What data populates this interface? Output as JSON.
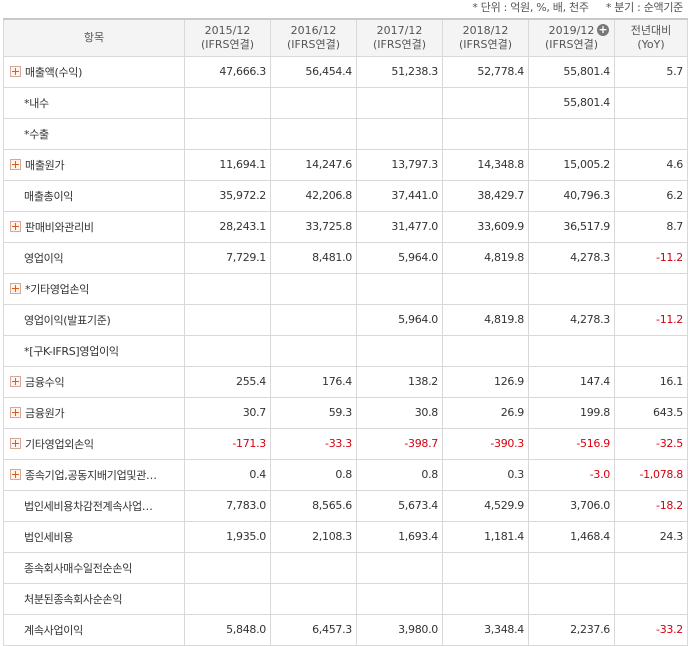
{
  "notes": {
    "unit": "* 단위 : 억원, %, 배, 천주",
    "quarter": "* 분기 : 순액기준"
  },
  "header": {
    "item": "항목",
    "periods": [
      {
        "year": "2015/12",
        "basis": "(IFRS연결)"
      },
      {
        "year": "2016/12",
        "basis": "(IFRS연결)"
      },
      {
        "year": "2017/12",
        "basis": "(IFRS연결)"
      },
      {
        "year": "2018/12",
        "basis": "(IFRS연결)"
      },
      {
        "year": "2019/12",
        "basis": "(IFRS연결)"
      }
    ],
    "yoy_line1": "전년대비",
    "yoy_line2": "(YoY)"
  },
  "rows": [
    {
      "label": "매출액(수익)",
      "expandable": true,
      "values": [
        "47,666.3",
        "56,454.4",
        "51,238.3",
        "52,778.4",
        "55,801.4",
        "5.7"
      ]
    },
    {
      "label": "*내수",
      "expandable": false,
      "values": [
        "",
        "",
        "",
        "",
        "55,801.4",
        ""
      ]
    },
    {
      "label": "*수출",
      "expandable": false,
      "values": [
        "",
        "",
        "",
        "",
        "",
        ""
      ]
    },
    {
      "label": "매출원가",
      "expandable": true,
      "values": [
        "11,694.1",
        "14,247.6",
        "13,797.3",
        "14,348.8",
        "15,005.2",
        "4.6"
      ]
    },
    {
      "label": "매출총이익",
      "expandable": false,
      "values": [
        "35,972.2",
        "42,206.8",
        "37,441.0",
        "38,429.7",
        "40,796.3",
        "6.2"
      ]
    },
    {
      "label": "판매비와관리비",
      "expandable": true,
      "values": [
        "28,243.1",
        "33,725.8",
        "31,477.0",
        "33,609.9",
        "36,517.9",
        "8.7"
      ]
    },
    {
      "label": "영업이익",
      "expandable": false,
      "values": [
        "7,729.1",
        "8,481.0",
        "5,964.0",
        "4,819.8",
        "4,278.3",
        "-11.2"
      ]
    },
    {
      "label": "*기타영업손익",
      "expandable": true,
      "values": [
        "",
        "",
        "",
        "",
        "",
        ""
      ]
    },
    {
      "label": "영업이익(발표기준)",
      "expandable": false,
      "values": [
        "",
        "",
        "5,964.0",
        "4,819.8",
        "4,278.3",
        "-11.2"
      ]
    },
    {
      "label": "*[구K-IFRS]영업이익",
      "expandable": false,
      "values": [
        "",
        "",
        "",
        "",
        "",
        ""
      ]
    },
    {
      "label": "금융수익",
      "expandable": true,
      "values": [
        "255.4",
        "176.4",
        "138.2",
        "126.9",
        "147.4",
        "16.1"
      ]
    },
    {
      "label": "금융원가",
      "expandable": true,
      "values": [
        "30.7",
        "59.3",
        "30.8",
        "26.9",
        "199.8",
        "643.5"
      ]
    },
    {
      "label": "기타영업외손익",
      "expandable": true,
      "values": [
        "-171.3",
        "-33.3",
        "-398.7",
        "-390.3",
        "-516.9",
        "-32.5"
      ]
    },
    {
      "label": "종속기업,공동지배기업및관…",
      "expandable": true,
      "values": [
        "0.4",
        "0.8",
        "0.8",
        "0.3",
        "-3.0",
        "-1,078.8"
      ]
    },
    {
      "label": "법인세비용차감전계속사업…",
      "expandable": false,
      "values": [
        "7,783.0",
        "8,565.6",
        "5,673.4",
        "4,529.9",
        "3,706.0",
        "-18.2"
      ]
    },
    {
      "label": "법인세비용",
      "expandable": false,
      "values": [
        "1,935.0",
        "2,108.3",
        "1,693.4",
        "1,181.4",
        "1,468.4",
        "24.3"
      ]
    },
    {
      "label": "종속회사매수일전순손익",
      "expandable": false,
      "values": [
        "",
        "",
        "",
        "",
        "",
        ""
      ]
    },
    {
      "label": "처분된종속회사순손익",
      "expandable": false,
      "values": [
        "",
        "",
        "",
        "",
        "",
        ""
      ]
    },
    {
      "label": "계속사업이익",
      "expandable": false,
      "values": [
        "5,848.0",
        "6,457.3",
        "3,980.0",
        "3,348.4",
        "2,237.6",
        "-33.2"
      ]
    }
  ]
}
